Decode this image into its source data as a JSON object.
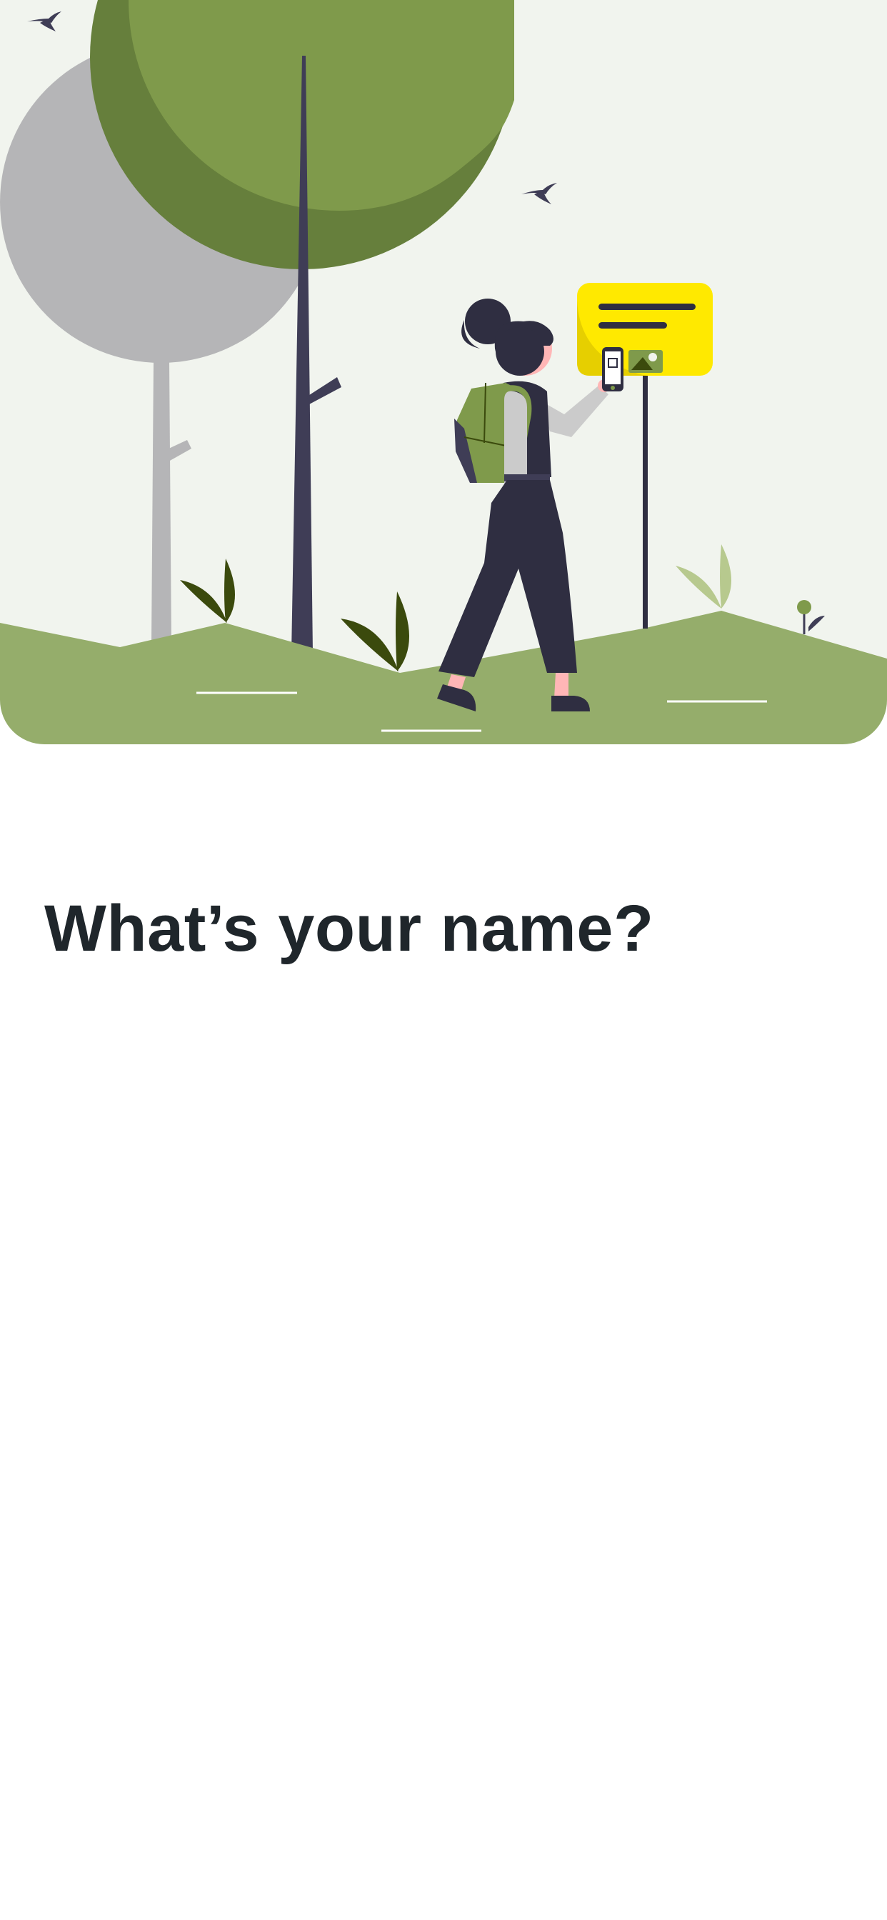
{
  "screen": {
    "title": "What’s your name?",
    "illustration": "woman-scanning-qr-sign-in-park-illustration"
  },
  "colors": {
    "hero_background": "#f1f4ee",
    "grass": "#95ad6b",
    "tree_green": "#7f9a4b",
    "tree_shadow": "#667f3c",
    "tree_gray": "#b5b5b7",
    "sign_yellow": "#ffe900",
    "dark": "#2f2e41",
    "title_text": "#1f262b"
  }
}
